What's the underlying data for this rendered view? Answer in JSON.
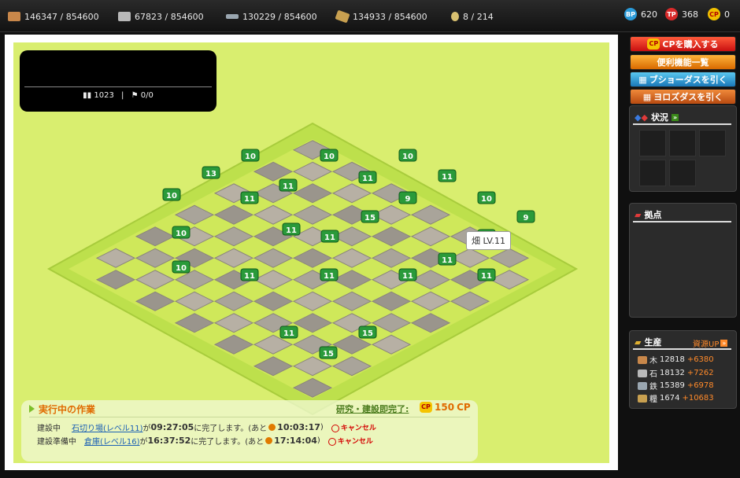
{
  "topbar": {
    "wood": {
      "value": "146347 / 854600",
      "icon": "wood-icon",
      "color": "#c8874a"
    },
    "stone": {
      "value": "67823 / 854600",
      "icon": "stone-icon",
      "color": "#b8b8b8"
    },
    "iron": {
      "value": "130229 / 854600",
      "icon": "iron-icon",
      "color": "#9aa6b0"
    },
    "grain": {
      "value": "134933 / 854600",
      "icon": "grain-icon",
      "color": "#c8a050"
    },
    "population": {
      "value": "8 / 214",
      "icon": "population-icon"
    },
    "bp": {
      "badge": "BP",
      "value": "620",
      "color": "#2a9ad8"
    },
    "tp": {
      "badge": "TP",
      "value": "368",
      "color": "#d82a2a"
    },
    "cp": {
      "badge": "CP",
      "value": "0",
      "color": "#f0c000"
    }
  },
  "map": {
    "infobox": {
      "soldiers": "1023",
      "separator": "|",
      "units": "0/0"
    },
    "tooltip": "畑 LV.11",
    "levels": [
      "10",
      "10",
      "10",
      "13",
      "11",
      "11",
      "10",
      "10",
      "10",
      "11",
      "11",
      "11",
      "11",
      "11",
      "10",
      "9",
      "9",
      "11",
      "11",
      "11",
      "11",
      "11",
      "11",
      "15",
      "15",
      "15"
    ]
  },
  "work": {
    "title": "実行中の作業",
    "instant_label": "研究・建設即完了:",
    "cp_cost": "150",
    "cp_unit": "CP",
    "rows": [
      {
        "status": "建設中",
        "target": "石切り場(レベル11)",
        "mid": "が",
        "time": "09:27:05",
        "suffix": "に完了します。(あと",
        "remaining": "10:03:17",
        "close": ")",
        "cancel": "キャンセル"
      },
      {
        "status": "建設準備中",
        "target": "倉庫(レベル16)",
        "mid": "が",
        "time": "16:37:52",
        "suffix": "に完了します。(あと",
        "remaining": "17:14:04",
        "close": ")",
        "cancel": "キャンセル"
      }
    ]
  },
  "sidebar": {
    "buy_cp": "CPを購入する",
    "features": "便利機能一覧",
    "bushou_draw": "ブショーダスを引く",
    "yorozu_draw": "ヨロズダスを引く",
    "status_title": "状況",
    "base_title": "拠点",
    "production_title": "生産",
    "resource_up": "資源UP",
    "production": [
      {
        "name": "木",
        "value": "12818",
        "plus": "+6380",
        "color": "#c8874a"
      },
      {
        "name": "石",
        "value": "18132",
        "plus": "+7262",
        "color": "#b8b8b8"
      },
      {
        "name": "鉄",
        "value": "15389",
        "plus": "+6978",
        "color": "#9aa6b0"
      },
      {
        "name": "糧",
        "value": "1674",
        "plus": "+10683",
        "color": "#c8a050"
      }
    ]
  }
}
